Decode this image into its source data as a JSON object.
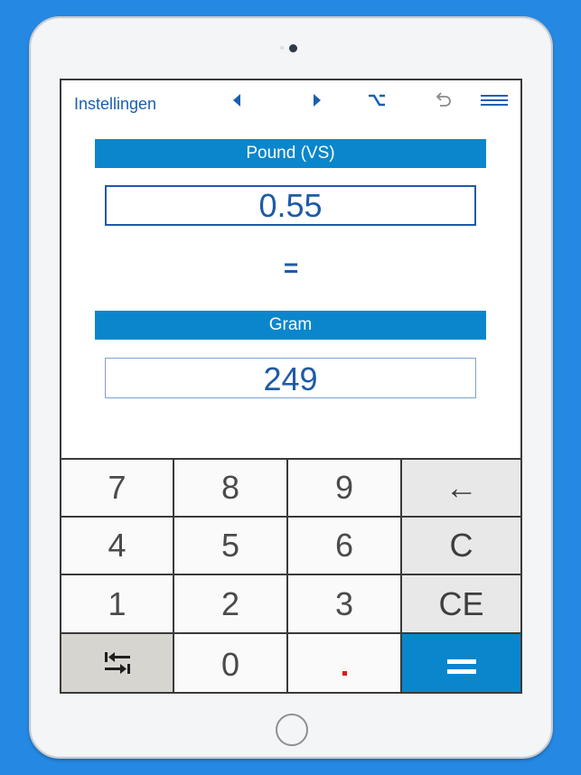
{
  "toolbar": {
    "settings_label": "Instellingen",
    "icons": [
      "prev-triangle-icon",
      "next-triangle-icon",
      "option-key-icon",
      "undo-icon",
      "menu-icon"
    ]
  },
  "converter": {
    "from_unit": "Pound (VS)",
    "from_value": "0.55",
    "equals": "=",
    "to_unit": "Gram",
    "to_value": "249"
  },
  "keypad": {
    "keys": [
      {
        "label": "7",
        "name": "key-7"
      },
      {
        "label": "8",
        "name": "key-8"
      },
      {
        "label": "9",
        "name": "key-9"
      },
      {
        "label": "←",
        "name": "backspace-key"
      },
      {
        "label": "4",
        "name": "key-4"
      },
      {
        "label": "5",
        "name": "key-5"
      },
      {
        "label": "6",
        "name": "key-6"
      },
      {
        "label": "C",
        "name": "clear-key"
      },
      {
        "label": "1",
        "name": "key-1"
      },
      {
        "label": "2",
        "name": "key-2"
      },
      {
        "label": "3",
        "name": "key-3"
      },
      {
        "label": "CE",
        "name": "clear-entry-key"
      },
      {
        "label": "",
        "name": "swap-units-key"
      },
      {
        "label": "0",
        "name": "key-0"
      },
      {
        "label": ".",
        "name": "decimal-key"
      },
      {
        "label": "",
        "name": "equals-key"
      }
    ]
  },
  "colors": {
    "background": "#2589e3",
    "accent": "#0a86cd",
    "value_text": "#1e5aa8",
    "decimal_point": "#e0161d"
  }
}
